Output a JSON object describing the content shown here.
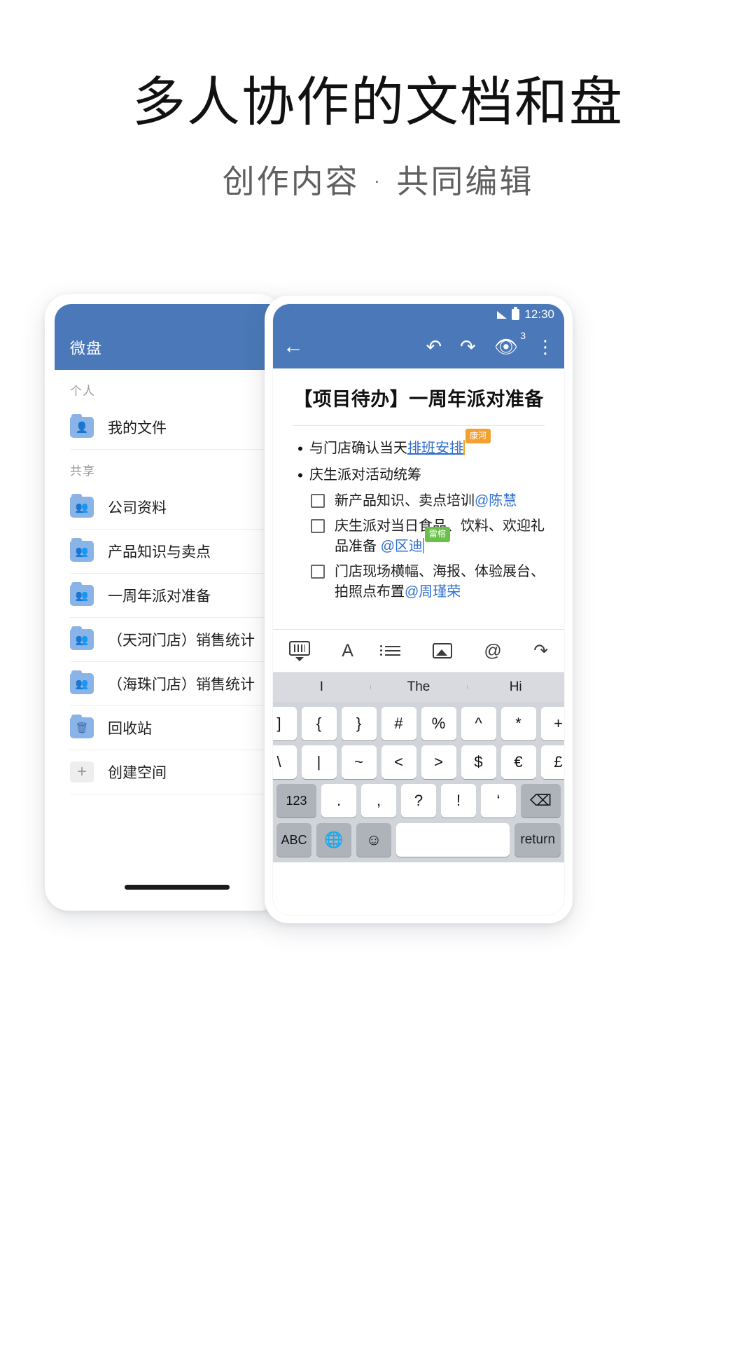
{
  "hero": {
    "title": "多人协作的文档和盘",
    "subtitle": "创作内容 · 共同编辑"
  },
  "left_phone": {
    "appbar": {
      "title": "微盘"
    },
    "sections": [
      {
        "label": "个人",
        "items": [
          {
            "label": "我的文件",
            "icon": "person-folder-icon"
          }
        ]
      },
      {
        "label": "共享",
        "items": [
          {
            "label": "公司资料",
            "icon": "group-folder-icon"
          },
          {
            "label": "产品知识与卖点",
            "icon": "group-folder-icon"
          },
          {
            "label": "一周年派对准备",
            "icon": "group-folder-icon"
          },
          {
            "label": "（天河门店）销售统计",
            "icon": "group-folder-icon"
          },
          {
            "label": "（海珠门店）销售统计",
            "icon": "group-folder-icon"
          },
          {
            "label": "回收站",
            "icon": "trash-folder-icon"
          },
          {
            "label": "创建空间",
            "icon": "plus-icon"
          }
        ]
      }
    ]
  },
  "right_phone": {
    "status_bar": {
      "time": "12:30",
      "signal_icon": "signal-icon",
      "battery_icon": "battery-icon"
    },
    "appbar": {
      "back_icon": "back-arrow-icon",
      "undo_icon": "undo-icon",
      "redo_icon": "redo-icon",
      "viewers_icon": "eye-icon",
      "viewers_count": "3",
      "more_icon": "more-vertical-icon"
    },
    "document": {
      "title": "【项目待办】一周年派对准备",
      "bullets": [
        {
          "type": "bullet",
          "prefix": "与门店确认当天",
          "link": "排班安排",
          "tag": {
            "text": "康河",
            "color": "#f2a030"
          }
        },
        {
          "type": "bullet",
          "prefix": "庆生派对活动统筹",
          "link": "",
          "tag": null
        }
      ],
      "checklist": [
        {
          "text": "新产品知识、卖点培训",
          "mention": "@陈慧",
          "tag": null
        },
        {
          "text": "庆生派对当日食品、饮料、欢迎礼品准备 ",
          "mention": "@区迪",
          "tag": {
            "text": "雷榕",
            "color": "#6cc04a"
          }
        },
        {
          "text": "门店现场横幅、海报、体验展台、拍照点布置",
          "mention": "@周瑾荣",
          "tag": null
        }
      ]
    },
    "format_bar": [
      {
        "name": "keyboard-hide-icon"
      },
      {
        "name": "text-format-icon",
        "glyph": "A"
      },
      {
        "name": "bullet-list-icon"
      },
      {
        "name": "image-icon"
      },
      {
        "name": "mention-icon",
        "glyph": "@"
      },
      {
        "name": "share-icon",
        "glyph": "↷"
      }
    ],
    "keyboard": {
      "suggestions": [
        "I",
        "The",
        "Hi"
      ],
      "row1": [
        "[",
        "]",
        "{",
        "}",
        "#",
        "%",
        "^",
        "*",
        "+",
        "="
      ],
      "row2": [
        "_",
        "\\",
        "|",
        "~",
        "<",
        ">",
        "$",
        "€",
        "£",
        "·"
      ],
      "row3_left": "123",
      "row3": [
        ".",
        ",",
        "?",
        "!",
        "‘"
      ],
      "row3_right": "⌫",
      "row4_abc": "ABC",
      "row4_globe": "globe-icon",
      "row4_emoji": "emoji-icon",
      "row4_space": "",
      "row4_return": "return"
    }
  },
  "colors": {
    "brand_blue": "#4a78b8",
    "link_blue": "#2f6fd0",
    "tag_orange": "#f2a030",
    "tag_green": "#6cc04a",
    "folder_blue": "#8ab4e8"
  }
}
